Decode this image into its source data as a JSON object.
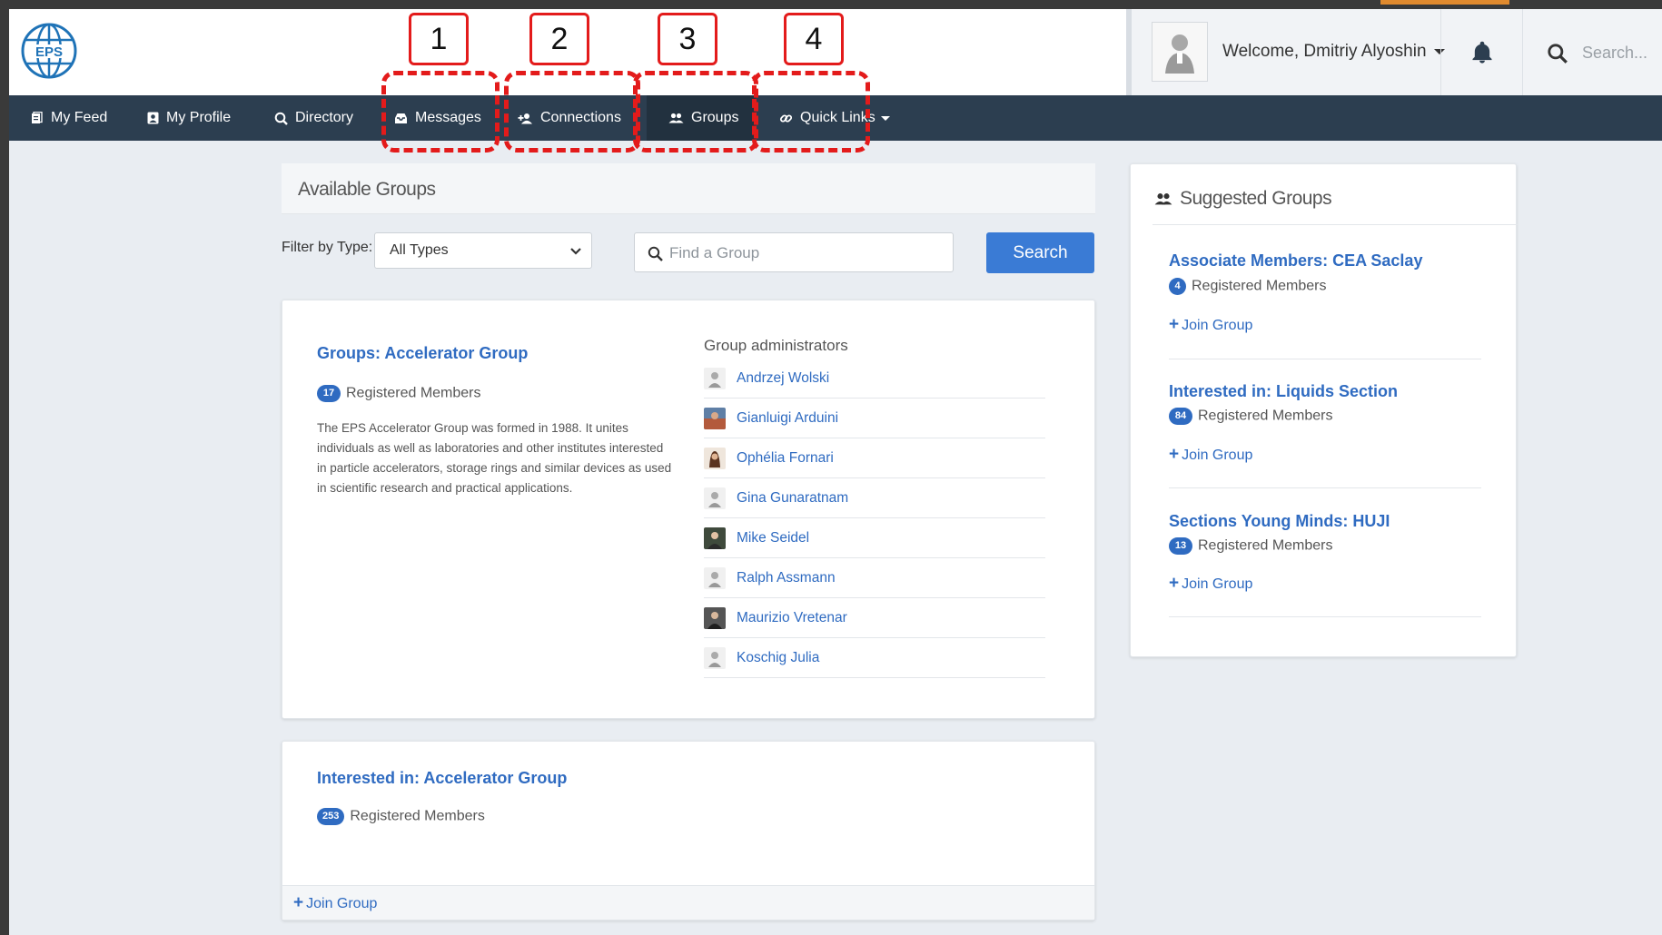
{
  "header": {
    "welcome": "Welcome, Dmitriy Alyoshin",
    "search_placeholder": "Search..."
  },
  "nav": {
    "items": [
      {
        "label": "My Feed",
        "icon": "feed-icon"
      },
      {
        "label": "My Profile",
        "icon": "profile-card-icon"
      },
      {
        "label": "Directory",
        "icon": "search-icon"
      },
      {
        "label": "Messages",
        "icon": "inbox-icon"
      },
      {
        "label": "Connections",
        "icon": "add-user-icon"
      },
      {
        "label": "Groups",
        "icon": "people-icon",
        "active": true
      },
      {
        "label": "Quick Links",
        "icon": "link-icon"
      }
    ]
  },
  "annotations": [
    "1",
    "2",
    "3",
    "4"
  ],
  "main": {
    "panel_title": "Available Groups",
    "filter_label": "Filter by Type:",
    "filter_value": "All Types",
    "find_placeholder": "Find a Group",
    "search_button": "Search",
    "groups": [
      {
        "title": "Groups: Accelerator Group",
        "count": "17",
        "members_label": "Registered Members",
        "description": "The EPS Accelerator Group was formed in 1988. It unites individuals as well as laboratories and other institutes interested in particle accelerators, storage rings and similar devices as used in scientific research and practical applications.",
        "admins_heading": "Group administrators",
        "admins": [
          "Andrzej Wolski",
          "Gianluigi Arduini",
          "Ophélia Fornari",
          "Gina Gunaratnam",
          "Mike Seidel",
          "Ralph Assmann",
          "Maurizio Vretenar",
          "Koschig Julia"
        ]
      },
      {
        "title": "Interested in: Accelerator Group",
        "count": "253",
        "members_label": "Registered Members",
        "join_label": "Join Group"
      }
    ]
  },
  "sidebar": {
    "title": "Suggested Groups",
    "groups": [
      {
        "title": "Associate Members: CEA Saclay",
        "count": "4",
        "members_label": "Registered Members",
        "join_label": "Join Group"
      },
      {
        "title": "Interested in: Liquids Section",
        "count": "84",
        "members_label": "Registered Members",
        "join_label": "Join Group"
      },
      {
        "title": "Sections Young Minds: HUJI",
        "count": "13",
        "members_label": "Registered Members",
        "join_label": "Join Group"
      }
    ]
  },
  "colors": {
    "nav_bg": "#2c3e50",
    "link": "#2f6bc1",
    "button": "#3a7bd5",
    "annotation": "#e31b1b",
    "accent_tab": "#e08a2e"
  }
}
